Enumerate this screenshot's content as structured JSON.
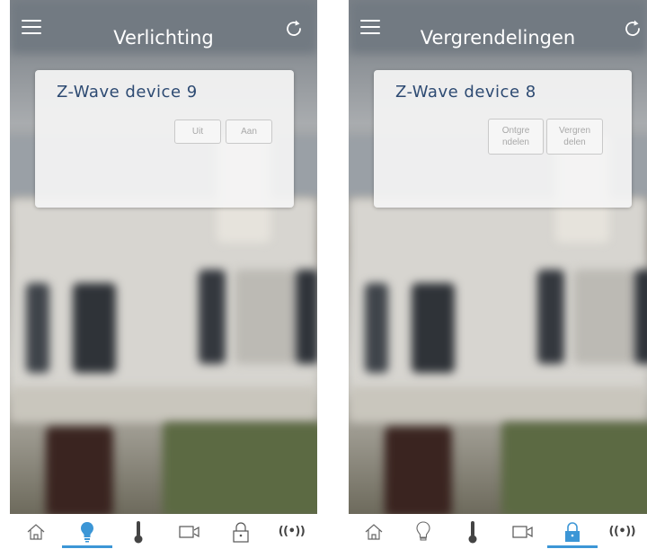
{
  "screens": [
    {
      "title": "Verlichting",
      "device": {
        "name": "Z-Wave device 9"
      },
      "buttons": [
        "Uit",
        "Aan"
      ],
      "active_tab": "lights"
    },
    {
      "title": "Vergrendelingen",
      "device": {
        "name": "Z-Wave device 8"
      },
      "buttons": [
        "Ontgre\nndelen",
        "Vergren\ndelen"
      ],
      "active_tab": "locks"
    }
  ],
  "tabs": [
    {
      "id": "home",
      "icon": "home-icon"
    },
    {
      "id": "lights",
      "icon": "lightbulb-icon"
    },
    {
      "id": "climate",
      "icon": "thermometer-icon"
    },
    {
      "id": "cameras",
      "icon": "camera-icon"
    },
    {
      "id": "locks",
      "icon": "lock-icon"
    },
    {
      "id": "sensors",
      "icon": "signal-icon",
      "label": "((•))"
    }
  ],
  "colors": {
    "accent": "#3c96d6",
    "device_title": "#2d4a72",
    "icon_default": "#555555"
  }
}
